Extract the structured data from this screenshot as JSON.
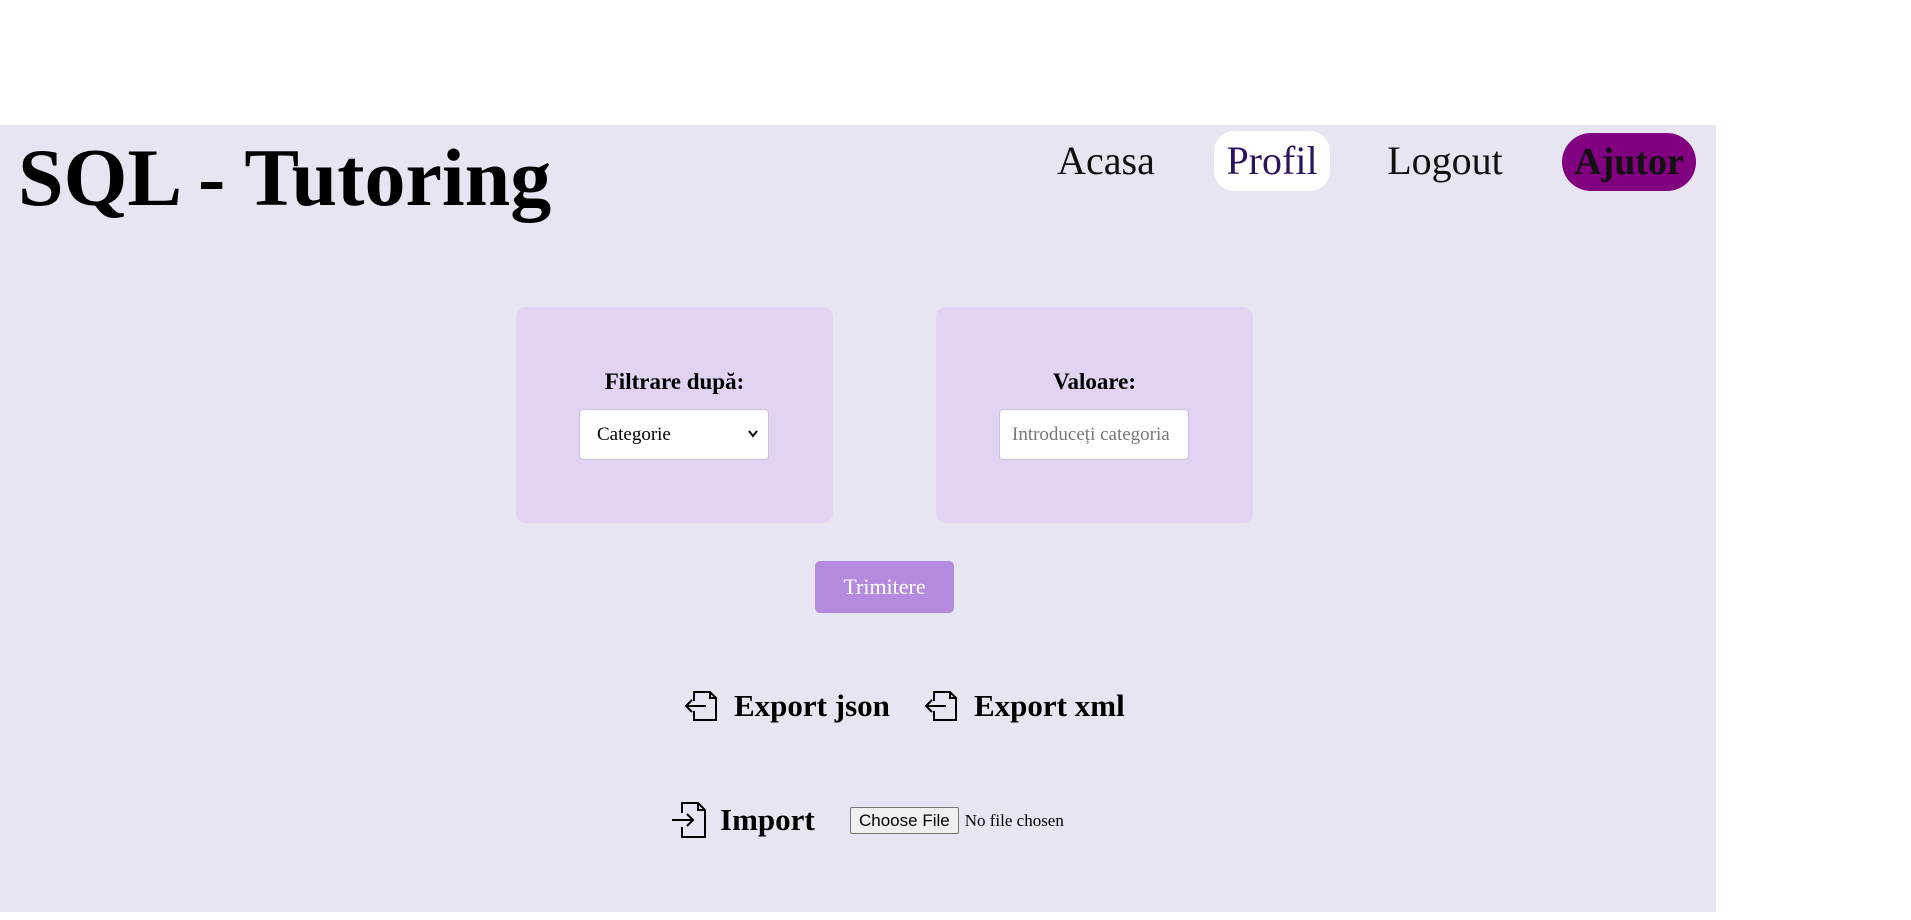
{
  "header": {
    "title": "SQL - Tutoring",
    "nav": [
      {
        "label": "Acasa"
      },
      {
        "label": "Profil"
      },
      {
        "label": "Logout"
      },
      {
        "label": "Ajutor"
      }
    ]
  },
  "filter": {
    "label": "Filtrare după:",
    "selected": "Categorie"
  },
  "value": {
    "label": "Valoare:",
    "placeholder": "Introduceți categoria"
  },
  "submit_label": "Trimitere",
  "exports": {
    "json_label": "Export json",
    "xml_label": "Export xml"
  },
  "import": {
    "label": "Import",
    "choose_label": "Choose File",
    "status": "No file chosen"
  },
  "colors": {
    "page_bg": "#e7e5f1",
    "card_bg": "#e1d3f1",
    "submit_bg": "#b48ade",
    "help_bg": "#800080"
  },
  "icons": {
    "export": "export-icon",
    "import": "import-icon",
    "dropdown": "chevron-down-icon"
  }
}
